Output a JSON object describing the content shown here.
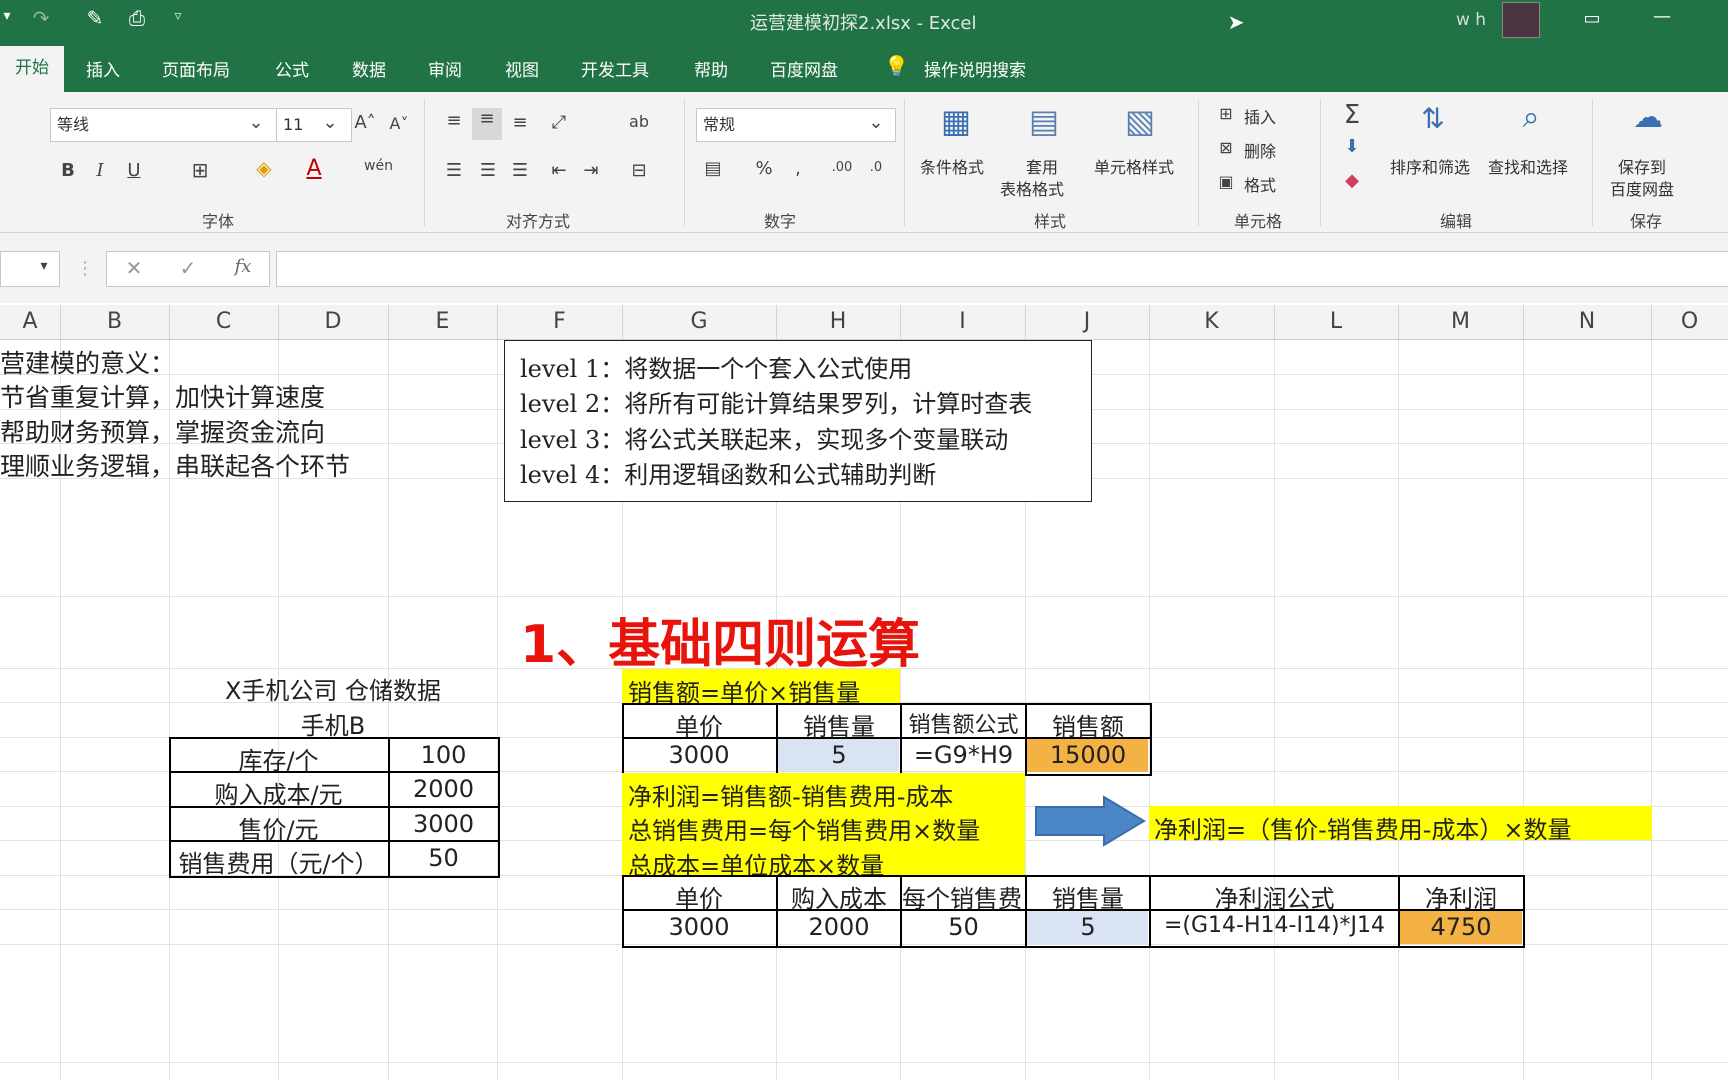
{
  "window": {
    "title": "运营建模初探2.xlsx  -  Excel",
    "user": "w h"
  },
  "ribbon_tabs": [
    "开始",
    "插入",
    "页面布局",
    "公式",
    "数据",
    "审阅",
    "视图",
    "开发工具",
    "帮助",
    "百度网盘"
  ],
  "tell_me": "操作说明搜索",
  "font": {
    "name": "等线",
    "size": "11",
    "group": "字体"
  },
  "groups": {
    "align": "对齐方式",
    "number": "数字",
    "styles": "样式",
    "cells": "单元格",
    "editing": "编辑",
    "save": "保存"
  },
  "number_format": "常规",
  "styles_buttons": {
    "cond": "条件格式",
    "table1": "套用",
    "table2": "表格格式",
    "cell": "单元格样式"
  },
  "cells_buttons": {
    "insert": "插入",
    "delete": "删除",
    "format": "格式"
  },
  "editing_buttons": {
    "sort": "排序和筛选",
    "find": "查找和选择"
  },
  "save_buttons": {
    "l1": "保存到",
    "l2": "百度网盘"
  },
  "columns": [
    "A",
    "B",
    "C",
    "D",
    "E",
    "F",
    "G",
    "H",
    "I",
    "J",
    "K",
    "L",
    "M",
    "N",
    "O"
  ],
  "intro": {
    "title": "营建模的意义：",
    "lines": [
      "节省重复计算，加快计算速度",
      "帮助财务预算，掌握资金流向",
      "理顺业务逻辑，串联起各个环节"
    ]
  },
  "levels": [
    "level 1：将数据一个个套入公式使用",
    "level 2：将所有可能计算结果罗列，计算时查表",
    "level 3：将公式关联起来，实现多个变量联动",
    "level 4：利用逻辑函数和公式辅助判断"
  ],
  "section_title": "1、基础四则运算",
  "warehouse": {
    "title": "X手机公司    仓储数据",
    "subtitle": "手机B",
    "rows": [
      {
        "label": "库存/个",
        "value": "100"
      },
      {
        "label": "购入成本/元",
        "value": "2000"
      },
      {
        "label": "售价/元",
        "value": "3000"
      },
      {
        "label": "销售费用（元/个）",
        "value": "50"
      }
    ]
  },
  "sales": {
    "formula_note": "销售额=单价×销售量",
    "headers": [
      "单价",
      "销售量",
      "销售额公式",
      "销售额"
    ],
    "row": [
      "3000",
      "5",
      "=G9*H9",
      "15000"
    ]
  },
  "profit": {
    "notes": [
      "净利润=销售额-销售费用-成本",
      "总销售费用=每个销售费用×数量",
      "总成本=单位成本×数量"
    ],
    "derived": "净利润=（售价-销售费用-成本）×数量",
    "headers": [
      "单价",
      "购入成本",
      "每个销售费",
      "销售量",
      "净利润公式",
      "净利润"
    ],
    "row": [
      "3000",
      "2000",
      "50",
      "5",
      "=(G14-H14-I14)*J14",
      "4750"
    ]
  },
  "colors": {
    "excel_green": "#217346",
    "highlight": "#ffff00",
    "result": "#f4b144",
    "input": "#dae3f3",
    "title_red": "#e8140c",
    "arrow": "#4a86c8"
  }
}
